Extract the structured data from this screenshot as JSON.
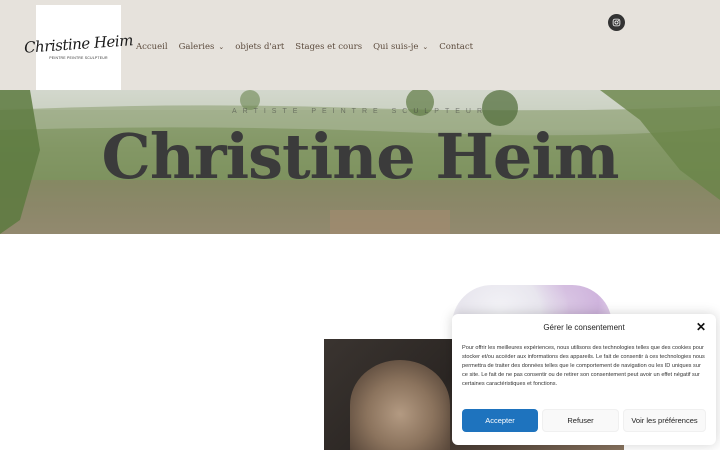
{
  "header": {
    "logo": {
      "script_text": "Christine Heim",
      "tagline": "PEINTRE PEINTRE SCULPTEUR"
    },
    "nav": [
      {
        "label": "Accueil",
        "has_dropdown": false
      },
      {
        "label": "Galeries",
        "has_dropdown": true
      },
      {
        "label": "objets d'art",
        "has_dropdown": false
      },
      {
        "label": "Stages et cours",
        "has_dropdown": false
      },
      {
        "label": "Qui suis-je",
        "has_dropdown": true
      },
      {
        "label": "Contact",
        "has_dropdown": false
      }
    ],
    "social_icon": "instagram-icon"
  },
  "hero": {
    "kicker": "ARTISTE PEINTRE SCULPTEUR",
    "title": "Christine Heim"
  },
  "consent": {
    "title": "Gérer le consentement",
    "text": "Pour offrir les meilleures expériences, nous utilisons des technologies telles que des cookies pour stocker et/ou accéder aux informations des appareils. Le fait de consentir à ces technologies nous permettra de traiter des données telles que le comportement de navigation ou les ID uniques sur ce site. Le fait de ne pas consentir ou de retirer son consentement peut avoir un effet négatif sur certaines caractéristiques et fonctions.",
    "accept_label": "Accepter",
    "refuse_label": "Refuser",
    "prefs_label": "Voir les préférences",
    "close_symbol": "✕"
  },
  "colors": {
    "header_bg": "#e6e2dc",
    "nav_text": "#5b4a3c",
    "accept_bg": "#1e73be"
  }
}
